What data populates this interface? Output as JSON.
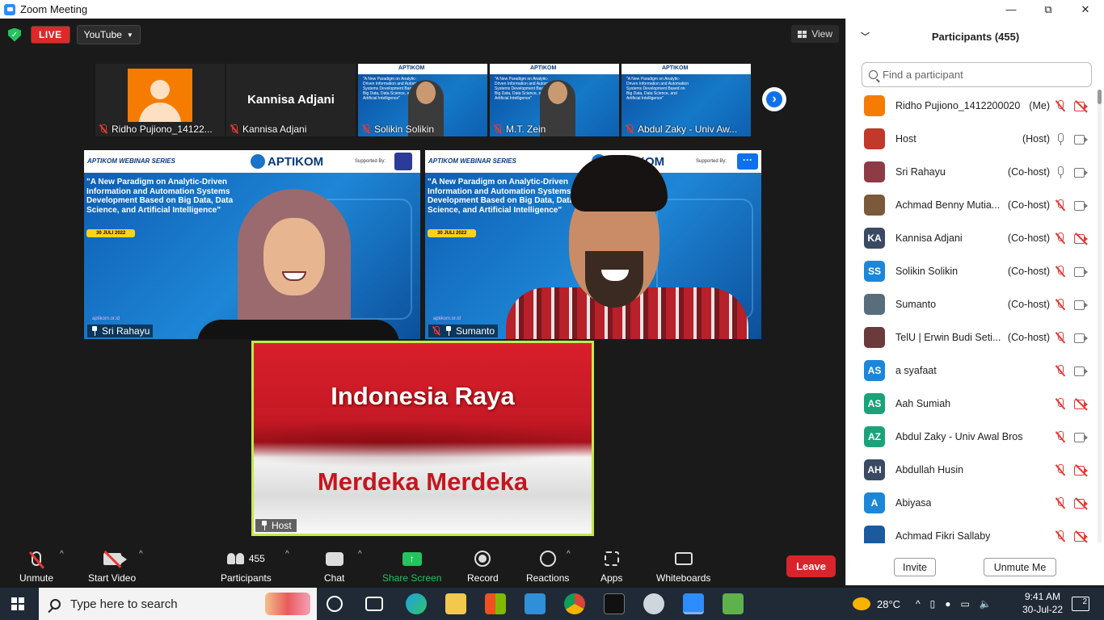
{
  "window": {
    "title": "Zoom Meeting",
    "minimize": "—",
    "maximize": "⧉",
    "close": "✕"
  },
  "top": {
    "live_label": "LIVE",
    "stream_target": "YouTube",
    "view_label": "View"
  },
  "filmstrip": [
    {
      "name": "Ridho Pujiono_14122...",
      "type": "avatar"
    },
    {
      "name": "Kannisa Adjani",
      "big_name": "Kannisa Adjani",
      "type": "name"
    },
    {
      "name": "Solikin Solikin",
      "type": "slide"
    },
    {
      "name": "M.T. Zein",
      "type": "slide"
    },
    {
      "name": "Abdul Zaky - Univ Aw...",
      "type": "slide"
    }
  ],
  "slide": {
    "series": "APTIKOM WEBINAR SERIES",
    "logo": "APTIKOM",
    "supported_by": "Supported By:",
    "title": "\"A New Paradigm on Analytic-Driven Information and Automation Systems Development Based on Big Data, Data Science, and Artificial Intelligence\"",
    "date": "30 JULI 2022",
    "site": "aptikom.or.id"
  },
  "mini_slide": {
    "logo": "APTIKOM",
    "title": "\"A New Paradigm on Analytic-Driven Information and Automation Systems Development Based on Big Data, Data Science, and Artificial Intelligence\""
  },
  "tiles": [
    {
      "name": "Sri Rahayu"
    },
    {
      "name": "Sumanto",
      "more": "···"
    }
  ],
  "host_tile": {
    "line1": "Indonesia Raya",
    "line2": "Merdeka Merdeka",
    "name": "Host"
  },
  "toolbar": {
    "unmute": "Unmute",
    "start_video": "Start Video",
    "participants": "Participants",
    "participant_count": "455",
    "chat": "Chat",
    "share_screen": "Share Screen",
    "record": "Record",
    "reactions": "Reactions",
    "apps": "Apps",
    "whiteboards": "Whiteboards",
    "leave": "Leave"
  },
  "panel": {
    "title": "Participants (455)",
    "search_placeholder": "Find a participant",
    "invite": "Invite",
    "unmute_me": "Unmute Me",
    "participants": [
      {
        "name": "Ridho Pujiono_1412200020",
        "role": "(Me)",
        "initials": "",
        "color": "#f57c00",
        "mic": "muted",
        "cam": "off"
      },
      {
        "name": "Host",
        "role": "(Host)",
        "initials": "",
        "color": "#c0392b",
        "mic": "on",
        "cam": "on"
      },
      {
        "name": "Sri Rahayu",
        "role": "(Co-host)",
        "initials": "",
        "color": "#8e3b46",
        "mic": "on",
        "cam": "on"
      },
      {
        "name": "Achmad Benny Mutia...",
        "role": "(Co-host)",
        "initials": "",
        "color": "#7a5a3a",
        "mic": "muted",
        "cam": "on"
      },
      {
        "name": "Kannisa Adjani",
        "role": "(Co-host)",
        "initials": "KA",
        "color": "#3b4a63",
        "mic": "muted",
        "cam": "off"
      },
      {
        "name": "Solikin Solikin",
        "role": "(Co-host)",
        "initials": "SS",
        "color": "#1b87d9",
        "mic": "muted",
        "cam": "on"
      },
      {
        "name": "Sumanto",
        "role": "(Co-host)",
        "initials": "",
        "color": "#5a6d7a",
        "mic": "muted",
        "cam": "on"
      },
      {
        "name": "TelU | Erwin Budi Seti...",
        "role": "(Co-host)",
        "initials": "",
        "color": "#6b3b3b",
        "mic": "muted",
        "cam": "on"
      },
      {
        "name": "a syafaat",
        "role": "",
        "initials": "AS",
        "color": "#1b87d9",
        "mic": "muted",
        "cam": "on"
      },
      {
        "name": "Aah Sumiah",
        "role": "",
        "initials": "AS",
        "color": "#1aa37a",
        "mic": "muted",
        "cam": "off"
      },
      {
        "name": "Abdul Zaky - Univ Awal Bros",
        "role": "",
        "initials": "AZ",
        "color": "#1aa37a",
        "mic": "muted",
        "cam": "on"
      },
      {
        "name": "Abdullah Husin",
        "role": "",
        "initials": "AH",
        "color": "#3b4a63",
        "mic": "muted",
        "cam": "off"
      },
      {
        "name": "Abiyasa",
        "role": "",
        "initials": "A",
        "color": "#1b87d9",
        "mic": "muted",
        "cam": "off"
      },
      {
        "name": "Achmad Fikri Sallaby",
        "role": "",
        "initials": "",
        "color": "#1c5aa0",
        "mic": "muted",
        "cam": "off"
      }
    ]
  },
  "taskbar": {
    "search_placeholder": "Type here to search",
    "temperature": "28°C",
    "time": "9:41 AM",
    "date": "30-Jul-22",
    "notifications": "2"
  }
}
